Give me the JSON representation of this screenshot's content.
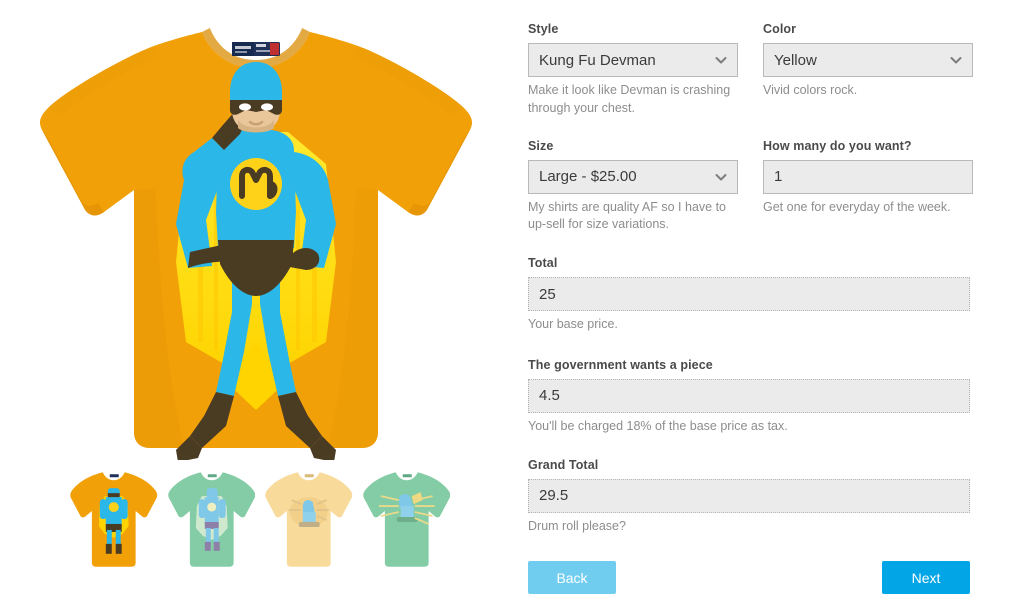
{
  "preview": {
    "main_shirt_alt": "Gold t-shirt with Kung Fu Devman superhero print",
    "shirt_color_hex": "#F2A007",
    "print": {
      "suit_hex": "#2BB7E8",
      "cape_hex": "#FFE000",
      "dark_hex": "#4A3B23",
      "skin_hex": "#E9C79B",
      "emblem_hex": "#FFD21A"
    },
    "thumbnails": [
      {
        "name": "thumb-gold-devman",
        "shirt_hex": "#F2A007",
        "selected": true,
        "label": "Gold"
      },
      {
        "name": "thumb-mint-devman",
        "shirt_hex": "#84CCA6",
        "selected": false,
        "label": "Mint"
      },
      {
        "name": "thumb-cream-devman",
        "shirt_hex": "#F8DA9B",
        "selected": false,
        "label": "Cream"
      },
      {
        "name": "thumb-green-devman",
        "shirt_hex": "#84CCA6",
        "selected": false,
        "label": "Green"
      }
    ]
  },
  "form": {
    "style": {
      "label": "Style",
      "value": "Kung Fu Devman",
      "help": "Make it look like Devman is crashing through your chest.",
      "icon": "chevron-down-icon"
    },
    "color": {
      "label": "Color",
      "value": "Yellow",
      "help": "Vivid colors rock.",
      "icon": "chevron-down-icon"
    },
    "size": {
      "label": "Size",
      "value": "Large - $25.00",
      "help": "My shirts are quality AF so I have to up-sell for size variations.",
      "icon": "chevron-down-icon"
    },
    "quantity": {
      "label": "How many do you want?",
      "value": "1",
      "help": "Get one for everyday of the week."
    },
    "total": {
      "label": "Total",
      "value": "25",
      "help": "Your base price."
    },
    "tax": {
      "label": "The government wants a piece",
      "value": "4.5",
      "help": "You'll be charged 18% of the base price as tax."
    },
    "grand_total": {
      "label": "Grand Total",
      "value": "29.5",
      "help": "Drum roll please?"
    },
    "buttons": {
      "back": "Back",
      "next": "Next",
      "back_color": "#71cdf0",
      "next_color": "#02a5e6"
    }
  }
}
